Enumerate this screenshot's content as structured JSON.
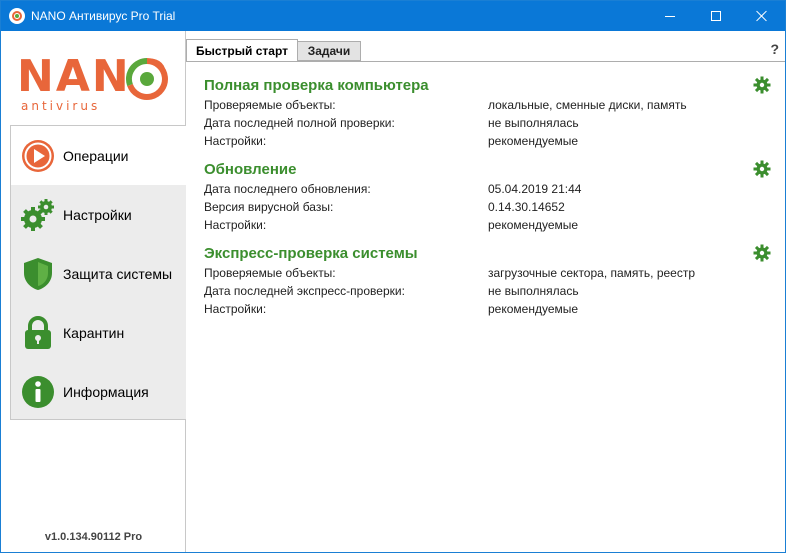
{
  "window": {
    "title": "NANO Антивирус Pro Trial"
  },
  "logo": {
    "brand": "NANO",
    "sub": "antivirus"
  },
  "nav": {
    "items": [
      {
        "label": "Операции",
        "icon": "play-icon",
        "active": true
      },
      {
        "label": "Настройки",
        "icon": "gears-icon",
        "active": false
      },
      {
        "label": "Защита системы",
        "icon": "shield-icon",
        "active": false
      },
      {
        "label": "Карантин",
        "icon": "lock-icon",
        "active": false
      },
      {
        "label": "Информация",
        "icon": "info-icon",
        "active": false
      }
    ]
  },
  "version": "v1.0.134.90112 Pro",
  "tabs": {
    "quick_start": "Быстрый старт",
    "tasks": "Задачи",
    "help": "?"
  },
  "sections": [
    {
      "title": "Полная проверка компьютера",
      "rows": [
        {
          "key": "Проверяемые объекты:",
          "value": "локальные, сменные диски, память"
        },
        {
          "key": "Дата последней полной проверки:",
          "value": "не выполнялась"
        },
        {
          "key": "Настройки:",
          "value": "рекомендуемые"
        }
      ]
    },
    {
      "title": "Обновление",
      "rows": [
        {
          "key": "Дата последнего обновления:",
          "value": "05.04.2019 21:44"
        },
        {
          "key": "Версия вирусной базы:",
          "value": "0.14.30.14652"
        },
        {
          "key": "Настройки:",
          "value": "рекомендуемые"
        }
      ]
    },
    {
      "title": "Экспресс-проверка системы",
      "rows": [
        {
          "key": "Проверяемые объекты:",
          "value": "загрузочные сектора, память, реестр"
        },
        {
          "key": "Дата последней экспресс-проверки:",
          "value": "не выполнялась"
        },
        {
          "key": "Настройки:",
          "value": "рекомендуемые"
        }
      ]
    }
  ],
  "colors": {
    "titlebar": "#0a78d7",
    "accent_orange": "#e8663a",
    "accent_green": "#3b8e2e"
  }
}
